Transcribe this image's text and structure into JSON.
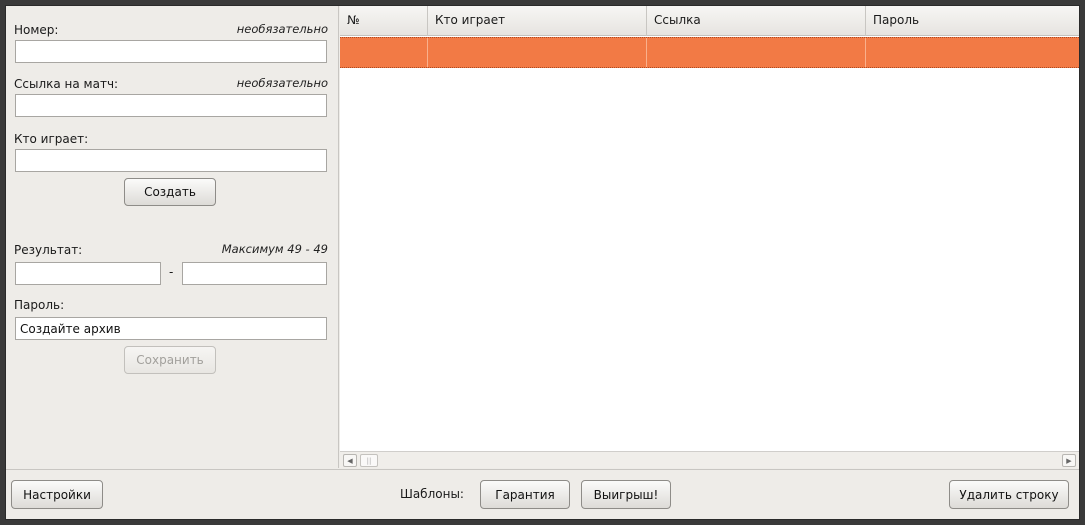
{
  "form": {
    "number_label": "Номер:",
    "number_hint": "необязательно",
    "number_value": "",
    "link_label": "Ссылка на матч:",
    "link_hint": "необязательно",
    "link_value": "",
    "players_label": "Кто играет:",
    "players_value": "",
    "create_button": "Создать",
    "result_label": "Результат:",
    "result_hint": "Максимум 49 - 49",
    "result_left": "",
    "result_separator": "-",
    "result_right": "",
    "password_label": "Пароль:",
    "password_value": "Создайте архив",
    "save_button": "Сохранить"
  },
  "table": {
    "columns": [
      "№",
      "Кто играет",
      "Ссылка",
      "Пароль"
    ],
    "rows": [
      {
        "number": "",
        "players": "",
        "link": "",
        "password": "",
        "selected": true
      }
    ],
    "selection_color": "#f27a45"
  },
  "bottom": {
    "settings_button": "Настройки",
    "templates_label": "Шаблоны:",
    "guarantee_button": "Гарантия",
    "win_button": "Выигрыш!",
    "delete_row_button": "Удалить строку"
  }
}
